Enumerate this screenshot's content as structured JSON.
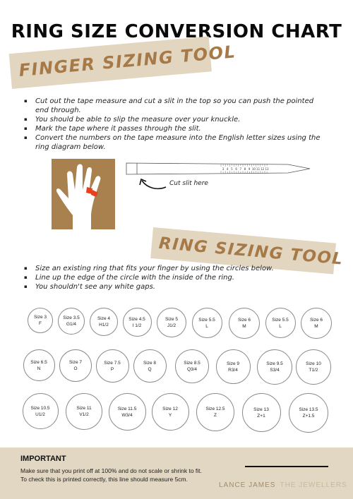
{
  "title": "RING SIZE CONVERSION CHART",
  "finger_tool": {
    "heading": "FINGER SIZING TOOL",
    "instructions": [
      "Cut out the tape measure and cut a slit in the top so you can push the pointed end through.",
      "You should be able to slip the measure over your knuckle.",
      "Mark the tape where it passes through the slit.",
      "Convert the numbers on the tape measure into the English letter sizes using the ring diagram below."
    ],
    "tape_numbers": [
      "3",
      "4",
      "5",
      "6",
      "7",
      "8",
      "9",
      "10",
      "11",
      "12",
      "13"
    ],
    "cut_label": "Cut slit here",
    "icons": {
      "hand": "hand-illustration-icon",
      "arrow": "curved-arrow-icon",
      "tape": "tape-measure-icon"
    }
  },
  "ring_tool": {
    "heading": "RING SIZING TOOL",
    "instructions": [
      "Size an existing ring that fits your finger by using the circles below.",
      "Line up the edge of the circle with the inside of the ring.",
      "You shouldn't see any white gaps."
    ],
    "rows": [
      [
        {
          "size": "Size 3",
          "letter": "F"
        },
        {
          "size": "Size 3.5",
          "letter": "G1/4"
        },
        {
          "size": "Size 4",
          "letter": "H1/2"
        },
        {
          "size": "Size 4.5",
          "letter": "I 1/2"
        },
        {
          "size": "Size 5",
          "letter": "J1/2"
        },
        {
          "size": "Size 5.5",
          "letter": "L"
        },
        {
          "size": "Size 6",
          "letter": "M"
        },
        {
          "size": "Size 5.5",
          "letter": "L"
        },
        {
          "size": "Size 6",
          "letter": "M"
        }
      ],
      [
        {
          "size": "Size 6.5",
          "letter": "N"
        },
        {
          "size": "Size 7",
          "letter": "O"
        },
        {
          "size": "Size 7.5",
          "letter": "P"
        },
        {
          "size": "Size 8",
          "letter": "Q"
        },
        {
          "size": "Size 8.5",
          "letter": "Q3/4"
        },
        {
          "size": "Size 9",
          "letter": "R3/4"
        },
        {
          "size": "Size 9.5",
          "letter": "S3/4"
        },
        {
          "size": "Size 10",
          "letter": "T1/2"
        }
      ],
      [
        {
          "size": "Size 10.5",
          "letter": "U1/2"
        },
        {
          "size": "Size 11",
          "letter": "V1/2"
        },
        {
          "size": "Size 11.5",
          "letter": "W3/4"
        },
        {
          "size": "Size 12",
          "letter": "Y"
        },
        {
          "size": "Size 12.5",
          "letter": "Z"
        },
        {
          "size": "Size 13",
          "letter": "Z+1"
        },
        {
          "size": "Size 13.5",
          "letter": "Z+1.5"
        }
      ]
    ]
  },
  "footer": {
    "heading": "IMPORTANT",
    "lines": [
      "Make sure that you print off at 100% and do not scale or shrink to fit.",
      "To check this is printed correctly, this line should measure 5cm."
    ],
    "brand_primary": "LANCE JAMES",
    "brand_secondary": "THE JEWELLERS"
  },
  "colors": {
    "banner_bg": "#e2d6c0",
    "banner_text": "#a67a48",
    "hand_bg": "#a8814f",
    "ring_marker": "#e8401c",
    "footer_bg": "#e2d7c3"
  }
}
